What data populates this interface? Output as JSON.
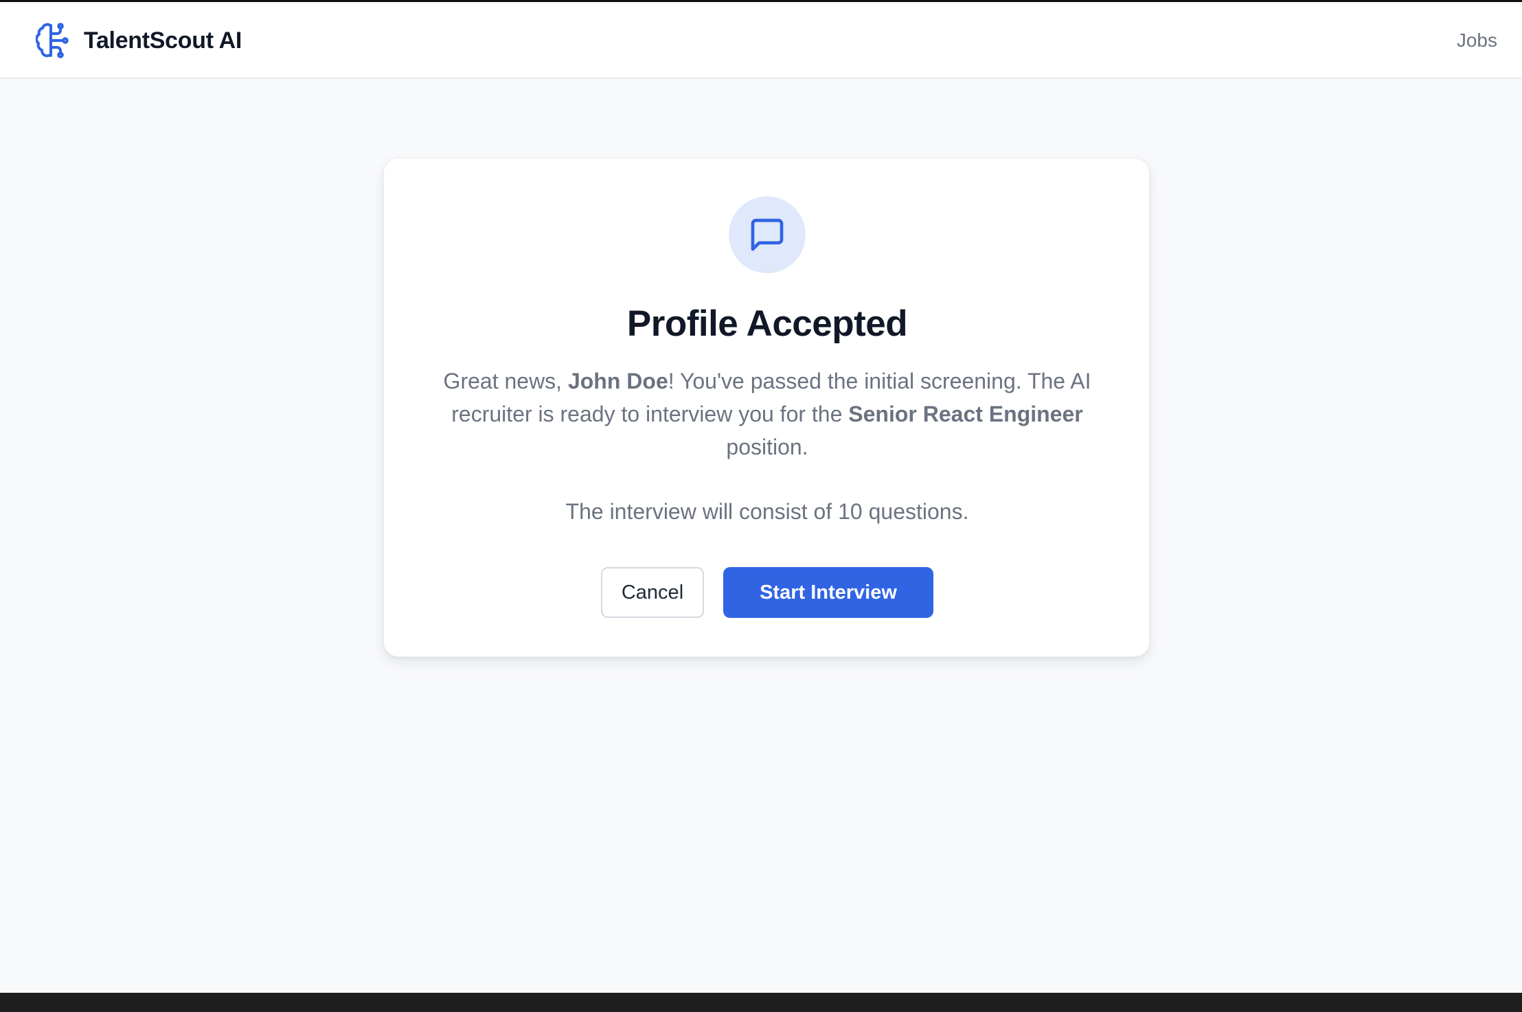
{
  "header": {
    "brand_name": "TalentScout AI",
    "brand_icon": "brain-icon",
    "nav_jobs": "Jobs"
  },
  "card": {
    "icon": "message-square-icon",
    "title": "Profile Accepted",
    "message": {
      "part1": "Great news, ",
      "candidate_name": "John Doe",
      "part2": "! You've passed the initial screening. The AI recruiter is ready to interview you for the ",
      "position": "Senior React Engineer",
      "part3": " position."
    },
    "note": "The interview will consist of 10 questions.",
    "cancel_label": "Cancel",
    "start_label": "Start Interview"
  },
  "colors": {
    "accent": "#3064e3",
    "icon_bg": "#dfe9fb",
    "title": "#111827",
    "body_text": "#6b7280",
    "page_bg": "#f8f9fb"
  }
}
